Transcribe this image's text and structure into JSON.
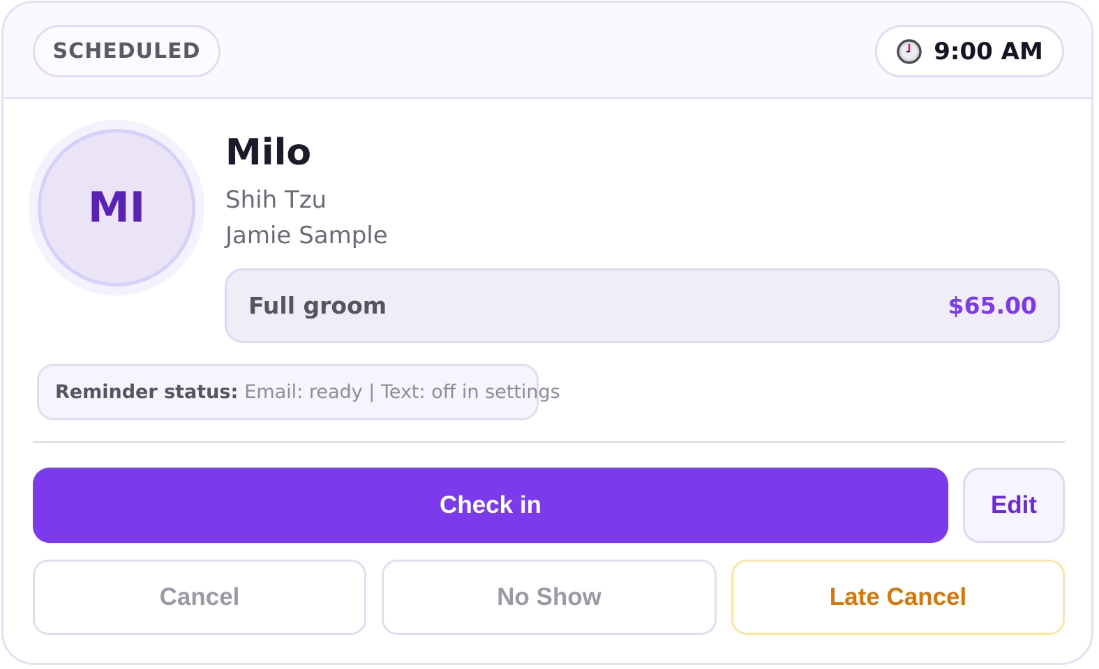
{
  "header": {
    "status": "SCHEDULED",
    "time": "9:00 AM",
    "time_icon": "clock-icon"
  },
  "pet": {
    "initials": "MI",
    "name": "Milo",
    "breed": "Shih Tzu",
    "owner": "Jamie Sample"
  },
  "service": {
    "name": "Full groom",
    "price": "$65.00"
  },
  "reminder": {
    "label": "Reminder status:",
    "value": "Email: ready | Text: off in settings"
  },
  "actions": {
    "check_in": "Check in",
    "edit": "Edit",
    "cancel": "Cancel",
    "no_show": "No Show",
    "late_cancel": "Late Cancel"
  },
  "colors": {
    "accent": "#7c3aed",
    "accent_dark": "#5b21b6",
    "warning": "#d97706",
    "muted": "#9a9aa5"
  }
}
